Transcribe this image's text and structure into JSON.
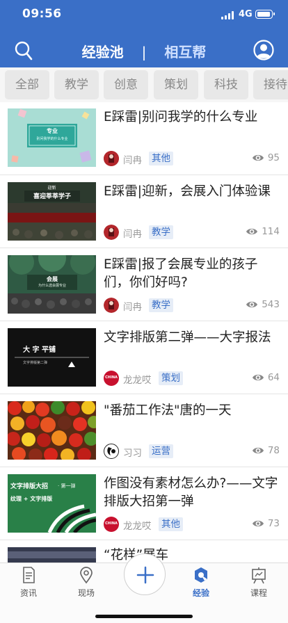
{
  "status": {
    "time": "09:56",
    "network": "4G"
  },
  "nav": {
    "tab_active": "经验池",
    "separator": "|",
    "tab_other": "相互帮"
  },
  "categories": [
    "全部",
    "教学",
    "创意",
    "策划",
    "科技",
    "接待"
  ],
  "items": [
    {
      "title": "E踩雷|别问我学的什么专业",
      "author": "闫冉",
      "tag": "其他",
      "views": "95",
      "thumb_text_1": "专业",
      "thumb_text_2": "别问我学的什么专业"
    },
    {
      "title": "E踩雷|迎新，会展入门体验课",
      "author": "闫冉",
      "tag": "教学",
      "views": "114",
      "thumb_text_1": "迎新",
      "thumb_text_2": "喜迎莘莘学子"
    },
    {
      "title": "E踩雷|报了会展专业的孩子们，你们好吗?",
      "author": "闫冉",
      "tag": "教学",
      "views": "543",
      "thumb_text_1": "会展",
      "thumb_text_2": "为什么选会展专业"
    },
    {
      "title": "文字排版第二弹——大字报法",
      "author": "龙龙哎",
      "tag": "策划",
      "views": "64",
      "thumb_text_1": "大 字 平铺",
      "thumb_text_2": "文字排版第二弹",
      "avatar_text": "CHINA"
    },
    {
      "title": "\"番茄工作法\"唐的一天",
      "author": "习习",
      "tag": "运营",
      "views": "78"
    },
    {
      "title": "作图没有素材怎么办?——文字排版大招第一弹",
      "author": "龙龙哎",
      "tag": "其他",
      "views": "73",
      "thumb_text_1": "文字排版大招",
      "thumb_text_1b": "· 第一弹",
      "thumb_text_2": "纹理 + 文字排版",
      "avatar_text": "CHINA"
    },
    {
      "title": "“花样”展车"
    }
  ],
  "tabbar": {
    "news": "资讯",
    "scene": "现场",
    "experience": "经验",
    "courses": "课程"
  },
  "colors": {
    "brand": "#3a6fc7",
    "tag_bg": "#e6edf7",
    "muted": "#999999"
  }
}
